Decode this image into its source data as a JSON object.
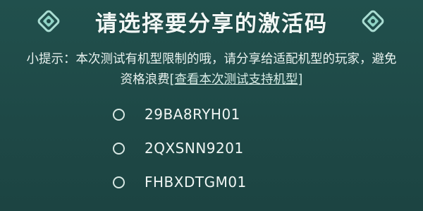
{
  "dialog": {
    "title": "请选择要分享的激活码",
    "hint_line1": "小提示：本次测试有机型限制的哦，请分享给适配机型的玩家，避免",
    "hint_line2_prefix": "资格浪费",
    "hint_link": "[查看本次测试支持机型]",
    "codes": [
      {
        "value": "29BA8RYH01",
        "selected": false
      },
      {
        "value": "2QXSNN9201",
        "selected": false
      },
      {
        "value": "FHBXDTGM01",
        "selected": false
      }
    ],
    "deco_icon": "diamond-ornament-icon",
    "colors": {
      "background": "#1f4a48",
      "text": "#eaf3f0",
      "accent": "#bfe8df"
    }
  }
}
